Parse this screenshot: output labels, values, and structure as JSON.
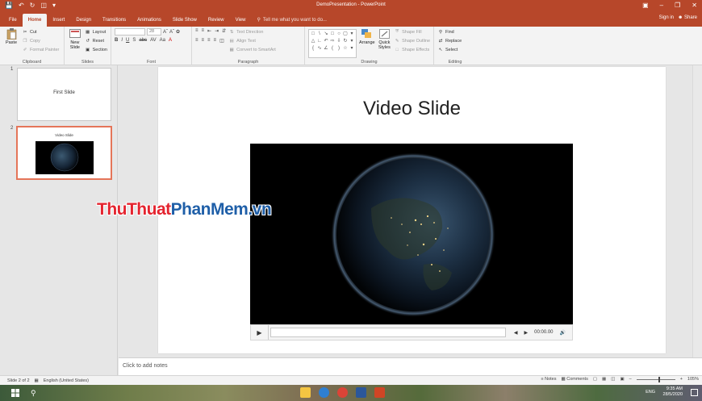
{
  "window": {
    "title": "DemoPresentation - PowerPoint",
    "sign_in": "Sign in",
    "share": "Share"
  },
  "tabs": [
    {
      "label": "File",
      "active": false
    },
    {
      "label": "Home",
      "active": true
    },
    {
      "label": "Insert",
      "active": false
    },
    {
      "label": "Design",
      "active": false
    },
    {
      "label": "Transitions",
      "active": false
    },
    {
      "label": "Animations",
      "active": false
    },
    {
      "label": "Slide Show",
      "active": false
    },
    {
      "label": "Review",
      "active": false
    },
    {
      "label": "View",
      "active": false
    }
  ],
  "tell_me": "Tell me what you want to do...",
  "ribbon": {
    "clipboard": {
      "label": "Clipboard",
      "paste": "Paste",
      "cut": "Cut",
      "copy": "Copy",
      "format_painter": "Format Painter"
    },
    "slides": {
      "label": "Slides",
      "new_slide": "New Slide",
      "layout": "Layout",
      "reset": "Reset",
      "section": "Section"
    },
    "font": {
      "label": "Font",
      "size": "28"
    },
    "paragraph": {
      "label": "Paragraph",
      "text_direction": "Text Direction",
      "align_text": "Align Text",
      "convert_smartart": "Convert to SmartArt"
    },
    "drawing": {
      "label": "Drawing",
      "arrange": "Arrange",
      "quick_styles": "Quick Styles",
      "shape_fill": "Shape Fill",
      "shape_outline": "Shape Outline",
      "shape_effects": "Shape Effects"
    },
    "editing": {
      "label": "Editing",
      "find": "Find",
      "replace": "Replace",
      "select": "Select"
    }
  },
  "thumbnails": [
    {
      "number": "1",
      "text": "First Slide",
      "selected": false
    },
    {
      "number": "2",
      "text": "Video Slide",
      "selected": true
    }
  ],
  "slide": {
    "title": "Video Slide",
    "video_time": "00:00.00"
  },
  "notes_placeholder": "Click to add notes",
  "statusbar": {
    "slide_info": "Slide 2 of 2",
    "language": "English (United States)",
    "notes": "Notes",
    "comments": "Comments",
    "zoom": "105%"
  },
  "taskbar": {
    "time": "9:35 AM",
    "date": "28/5/2020",
    "lang": "ENG"
  },
  "watermark": {
    "part1": "ThuThuat",
    "part2": "PhanMem",
    "part3": ".vn"
  },
  "colors": {
    "accent": "#b7472a",
    "selection": "#e57559"
  }
}
